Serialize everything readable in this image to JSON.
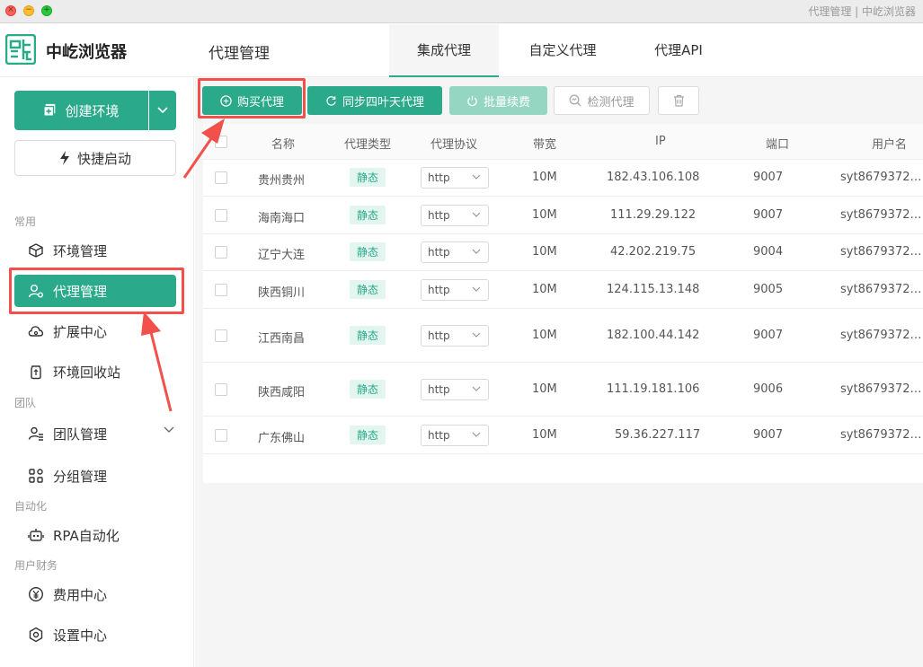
{
  "window": {
    "title": "代理管理 | 中屹浏览器",
    "close_glyph": "×",
    "min_glyph": "−",
    "max_glyph": "+"
  },
  "app": {
    "name": "中屹浏览器",
    "brand_color": "#2aaa8a"
  },
  "header": {
    "page_title": "代理管理",
    "tabs": [
      {
        "label": "集成代理",
        "active": true
      },
      {
        "label": "自定义代理",
        "active": false
      },
      {
        "label": "代理API",
        "active": false
      }
    ]
  },
  "sidebar": {
    "create_label": "创建环境",
    "quick_label": "快捷启动",
    "sections": {
      "common": "常用",
      "team": "团队",
      "automation": "自动化",
      "finance": "用户财务"
    },
    "items": [
      {
        "label": "环境管理",
        "icon": "cube-icon"
      },
      {
        "label": "代理管理",
        "icon": "proxy-user-icon",
        "active": true
      },
      {
        "label": "扩展中心",
        "icon": "cloud-gear-icon"
      },
      {
        "label": "环境回收站",
        "icon": "recycle-bin-icon"
      },
      {
        "label": "团队管理",
        "icon": "team-icon"
      },
      {
        "label": "分组管理",
        "icon": "group-icon"
      },
      {
        "label": "RPA自动化",
        "icon": "robot-icon"
      },
      {
        "label": "费用中心",
        "icon": "yen-icon"
      },
      {
        "label": "设置中心",
        "icon": "settings-icon"
      }
    ]
  },
  "toolbar": {
    "buy_label": "购买代理",
    "sync_label": "同步四叶天代理",
    "renew_label": "批量续费",
    "check_label": "检测代理"
  },
  "table": {
    "headers": {
      "name": "名称",
      "type": "代理类型",
      "protocol": "代理协议",
      "bandwidth": "带宽",
      "ip": "IP",
      "port": "端口",
      "user": "用户名"
    },
    "rows": [
      {
        "name": "贵州贵州",
        "type": "静态",
        "protocol": "http",
        "bandwidth": "10M",
        "ip": "182.43.106.108",
        "port": "9007",
        "user": "syt8679372…"
      },
      {
        "name": "海南海口",
        "type": "静态",
        "protocol": "http",
        "bandwidth": "10M",
        "ip": "111.29.29.122",
        "port": "9007",
        "user": "syt8679372…"
      },
      {
        "name": "辽宁大连",
        "type": "静态",
        "protocol": "http",
        "bandwidth": "10M",
        "ip": "42.202.219.75",
        "port": "9004",
        "user": "syt8679372…"
      },
      {
        "name": "陕西铜川",
        "type": "静态",
        "protocol": "http",
        "bandwidth": "10M",
        "ip": "124.115.13.148",
        "port": "9005",
        "user": "syt8679372…"
      },
      {
        "name": "江西南昌",
        "type": "静态",
        "protocol": "http",
        "bandwidth": "10M",
        "ip": "182.100.44.142",
        "port": "9007",
        "user": "syt8679372…"
      },
      {
        "name": "陕西咸阳",
        "type": "静态",
        "protocol": "http",
        "bandwidth": "10M",
        "ip": "111.19.181.106",
        "port": "9006",
        "user": "syt8679372…"
      },
      {
        "name": "广东佛山",
        "type": "静态",
        "protocol": "http",
        "bandwidth": "10M",
        "ip": "59.36.227.117",
        "port": "9007",
        "user": "syt8679372…"
      }
    ]
  },
  "annotation_color": "#f2504b"
}
